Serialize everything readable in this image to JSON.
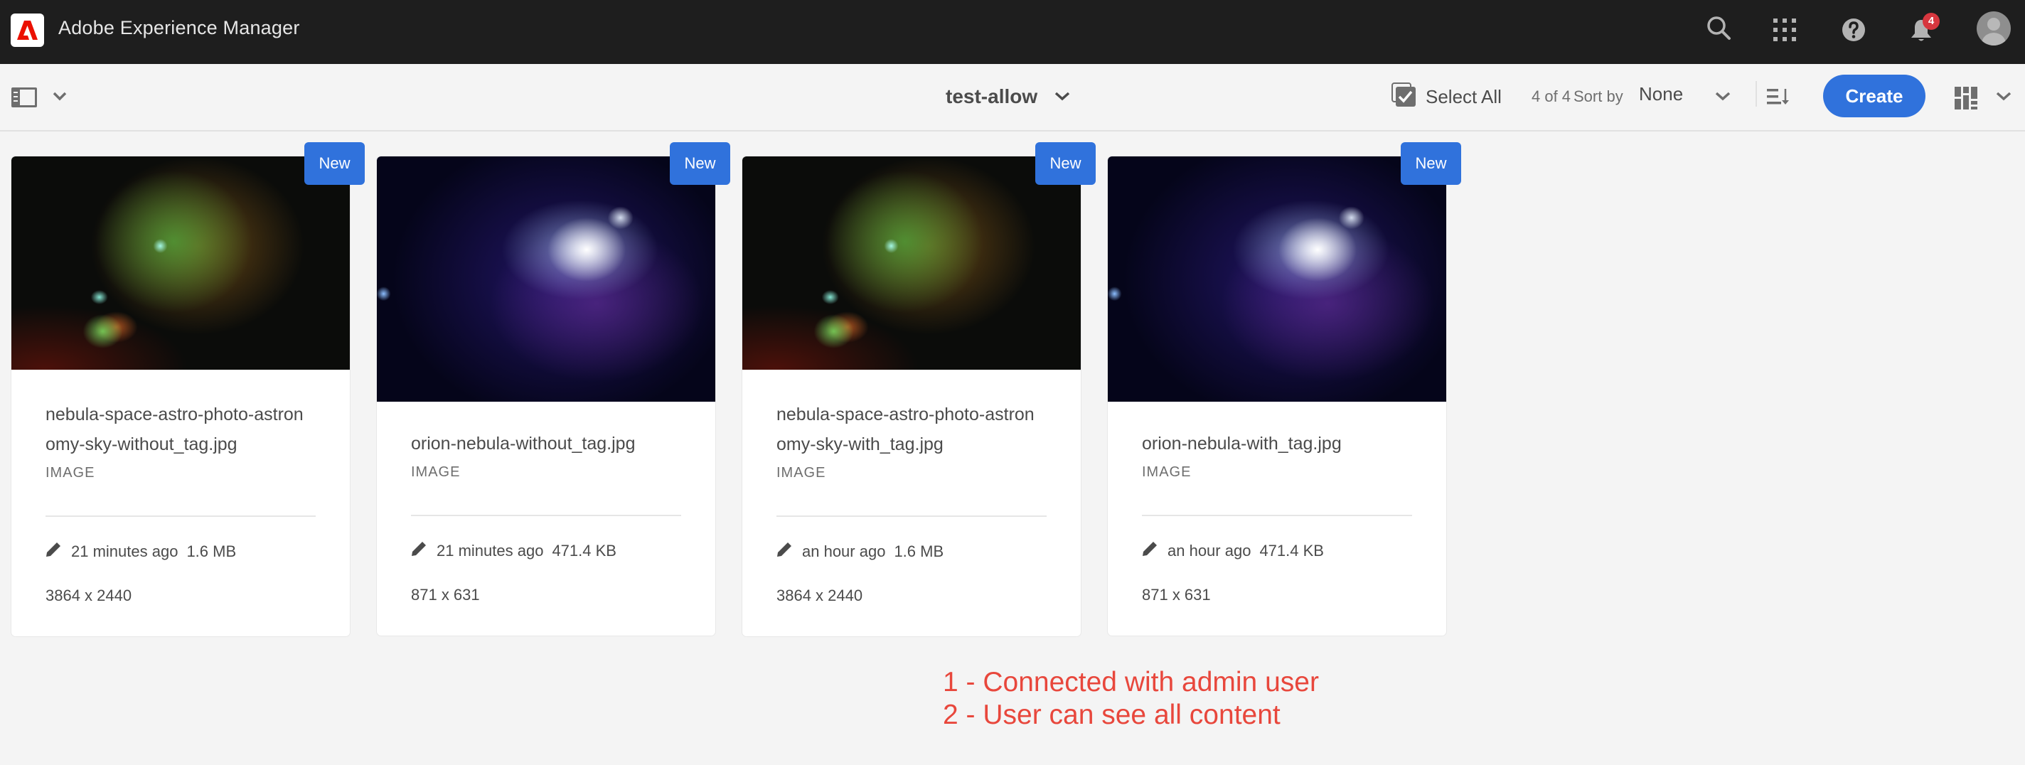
{
  "header": {
    "app_title": "Adobe Experience Manager",
    "icons": [
      "adobe-logo-icon",
      "search-icon",
      "solutions-grid-icon",
      "help-icon",
      "bell-icon",
      "user-avatar-icon"
    ],
    "notification_count": "4"
  },
  "toolbar": {
    "rail_toggle_icon": "rail-toggle-icon",
    "folder_title": "test-allow",
    "select_all_label": "Select All",
    "count_label": "4 of 4",
    "sort_by_label": "Sort by",
    "sort_value": "None",
    "create_label": "Create",
    "view_icon": "card-view-icon"
  },
  "cards": [
    {
      "title": "nebula-space-astro-photo-astronomy-sky-without_tag.jpg",
      "type": "IMAGE",
      "badge": "New",
      "modified": "21 minutes ago",
      "size": "1.6 MB",
      "dimensions": "3864 x 2440"
    },
    {
      "title": "orion-nebula-without_tag.jpg",
      "type": "IMAGE",
      "badge": "New",
      "modified": "21 minutes ago",
      "size": "471.4 KB",
      "dimensions": "871 x 631"
    },
    {
      "title": "nebula-space-astro-photo-astronomy-sky-with_tag.jpg",
      "type": "IMAGE",
      "badge": "New",
      "modified": "an hour ago",
      "size": "1.6 MB",
      "dimensions": "3864 x 2440"
    },
    {
      "title": "orion-nebula-with_tag.jpg",
      "type": "IMAGE",
      "badge": "New",
      "modified": "an hour ago",
      "size": "471.4 KB",
      "dimensions": "871 x 631"
    }
  ],
  "annotation": {
    "line1": "1 - Connected with admin user",
    "line2": "2 - User can see all content"
  },
  "colors": {
    "accent": "#3072dc",
    "header_bg": "#1e1e1e",
    "annotation": "#e8473c",
    "notification": "#d7373f"
  }
}
